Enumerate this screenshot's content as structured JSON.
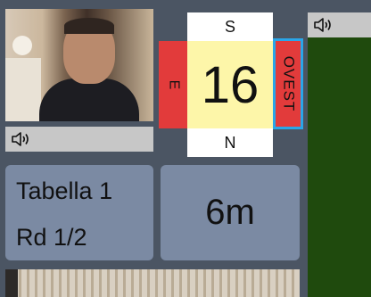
{
  "players": {
    "north_video": {
      "audio_icon": "speaker-icon"
    },
    "east_video": {
      "audio_icon": "speaker-icon"
    }
  },
  "table_info": {
    "table_label": "Tabella 1",
    "round_label": "Rd 1/2"
  },
  "timer": {
    "value": "6m"
  },
  "compass": {
    "top": "S",
    "bottom": "N",
    "left": "E",
    "right": "OVEST",
    "center_number": "16"
  },
  "colors": {
    "background": "#4b5563",
    "panel": "#7b8aa3",
    "compass_center": "#fdf6a9",
    "compass_side": "#e23b3b",
    "active_highlight": "#2aa6e8",
    "right_video": "#1f4a0d"
  }
}
